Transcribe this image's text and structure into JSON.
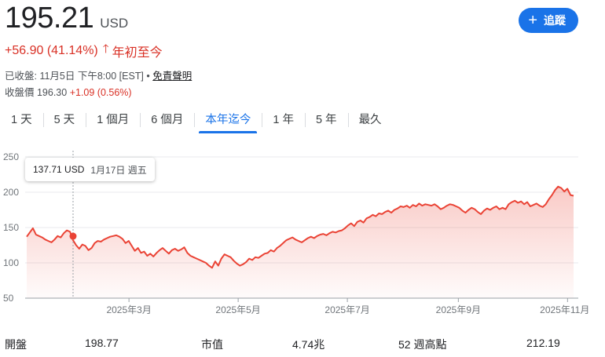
{
  "quote": {
    "price": "195.21",
    "currency": "USD",
    "change": "+56.90 (41.14%)",
    "change_period": "年初至今",
    "close_info": "已收盤: 11月5日 下午8:00 [EST] • ",
    "disclaimer_link": "免責聲明",
    "after_hours_label": "收盤價 196.30 ",
    "after_hours_change": "+1.09 (0.56%)"
  },
  "follow_button": {
    "label": "追蹤",
    "icon": "plus-icon"
  },
  "range_tabs": {
    "items": [
      "1 天",
      "5 天",
      "1 個月",
      "6 個月",
      "本年迄今",
      "1 年",
      "5 年",
      "最久"
    ],
    "active_index": 4
  },
  "tooltip": {
    "price": "137.71 USD",
    "date": "1月17日 週五"
  },
  "colors": {
    "accent": "#1a73e8",
    "line": "#ea4335",
    "negative": "#d93025"
  },
  "chart_data": {
    "type": "area",
    "y_ticks": [
      "250",
      "200",
      "150",
      "100",
      "50"
    ],
    "x_ticks": [
      "2025年3月",
      "2025年5月",
      "2025年7月",
      "2025年9月",
      "2025年11月"
    ],
    "x_tick_day_index": [
      58,
      119,
      180,
      242,
      303
    ],
    "ylim": [
      50,
      250
    ],
    "grid": true,
    "values": [
      137,
      143,
      149,
      140,
      138,
      136,
      133,
      131,
      129,
      133,
      138,
      136,
      142,
      146,
      144,
      132,
      125,
      120,
      126,
      124,
      118,
      121,
      128,
      131,
      130,
      133,
      135,
      137,
      138,
      139,
      137,
      134,
      128,
      131,
      124,
      117,
      121,
      114,
      116,
      110,
      113,
      109,
      114,
      118,
      121,
      117,
      113,
      118,
      120,
      117,
      119,
      122,
      114,
      110,
      108,
      106,
      104,
      102,
      100,
      96,
      93,
      102,
      96,
      106,
      112,
      110,
      108,
      103,
      99,
      96,
      98,
      101,
      106,
      104,
      108,
      107,
      110,
      113,
      114,
      118,
      116,
      121,
      124,
      128,
      132,
      134,
      136,
      133,
      131,
      129,
      132,
      135,
      137,
      135,
      138,
      140,
      141,
      139,
      142,
      144,
      143,
      145,
      146,
      149,
      153,
      156,
      152,
      158,
      160,
      157,
      163,
      165,
      168,
      166,
      170,
      169,
      172,
      174,
      171,
      175,
      177,
      180,
      179,
      181,
      178,
      182,
      180,
      184,
      181,
      183,
      182,
      181,
      183,
      180,
      176,
      178,
      181,
      183,
      182,
      180,
      178,
      174,
      171,
      175,
      178,
      176,
      172,
      169,
      174,
      177,
      175,
      178,
      180,
      176,
      178,
      176,
      183,
      186,
      188,
      185,
      187,
      183,
      186,
      180,
      182,
      184,
      181,
      179,
      183,
      190,
      196,
      203,
      208,
      206,
      201,
      205,
      196,
      195
    ],
    "days_start_index": 2,
    "days_total": 309,
    "marker_index": 15,
    "marker_value": 137.71
  },
  "stats": {
    "open_label": "開盤",
    "open_value": "198.77",
    "mktcap_label": "市值",
    "mktcap_value": "4.74兆",
    "high52_label": "52 週高點",
    "high52_value": "212.19"
  }
}
